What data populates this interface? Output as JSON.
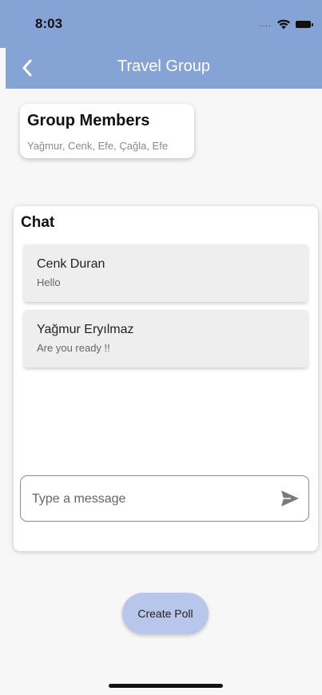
{
  "status_bar": {
    "time": "8:03",
    "signal_dots": "....",
    "icons": [
      "wifi-icon",
      "battery-icon"
    ]
  },
  "app_bar": {
    "title": "Travel Group",
    "back_icon": "chevron-left-icon",
    "color": "#86a3d6"
  },
  "group_members": {
    "title": "Group Members",
    "members_text": "Yağmur, Cenk, Efe, Çağla, Efe"
  },
  "chat": {
    "title": "Chat",
    "messages": [
      {
        "sender": "Cenk Duran",
        "text": "Hello"
      },
      {
        "sender": "Yağmur Eryılmaz",
        "text": "Are you ready !!"
      }
    ],
    "input": {
      "placeholder": "Type a message",
      "value": ""
    },
    "send_icon": "send-icon"
  },
  "actions": {
    "create_poll_label": "Create Poll",
    "button_color": "#b9c6ec"
  }
}
